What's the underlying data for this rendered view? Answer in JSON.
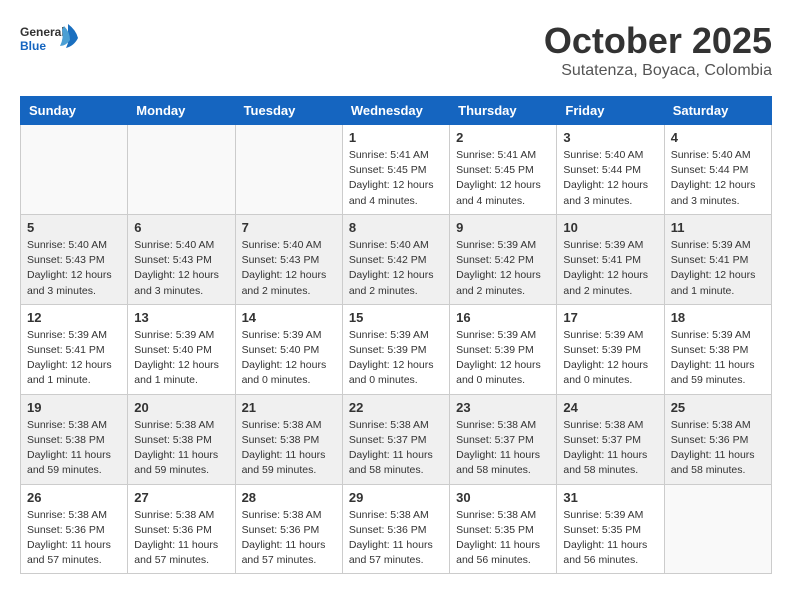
{
  "header": {
    "logo_general": "General",
    "logo_blue": "Blue",
    "month": "October 2025",
    "location": "Sutatenza, Boyaca, Colombia"
  },
  "days_of_week": [
    "Sunday",
    "Monday",
    "Tuesday",
    "Wednesday",
    "Thursday",
    "Friday",
    "Saturday"
  ],
  "weeks": [
    {
      "shaded": false,
      "days": [
        {
          "num": "",
          "info": ""
        },
        {
          "num": "",
          "info": ""
        },
        {
          "num": "",
          "info": ""
        },
        {
          "num": "1",
          "info": "Sunrise: 5:41 AM\nSunset: 5:45 PM\nDaylight: 12 hours\nand 4 minutes."
        },
        {
          "num": "2",
          "info": "Sunrise: 5:41 AM\nSunset: 5:45 PM\nDaylight: 12 hours\nand 4 minutes."
        },
        {
          "num": "3",
          "info": "Sunrise: 5:40 AM\nSunset: 5:44 PM\nDaylight: 12 hours\nand 3 minutes."
        },
        {
          "num": "4",
          "info": "Sunrise: 5:40 AM\nSunset: 5:44 PM\nDaylight: 12 hours\nand 3 minutes."
        }
      ]
    },
    {
      "shaded": true,
      "days": [
        {
          "num": "5",
          "info": "Sunrise: 5:40 AM\nSunset: 5:43 PM\nDaylight: 12 hours\nand 3 minutes."
        },
        {
          "num": "6",
          "info": "Sunrise: 5:40 AM\nSunset: 5:43 PM\nDaylight: 12 hours\nand 3 minutes."
        },
        {
          "num": "7",
          "info": "Sunrise: 5:40 AM\nSunset: 5:43 PM\nDaylight: 12 hours\nand 2 minutes."
        },
        {
          "num": "8",
          "info": "Sunrise: 5:40 AM\nSunset: 5:42 PM\nDaylight: 12 hours\nand 2 minutes."
        },
        {
          "num": "9",
          "info": "Sunrise: 5:39 AM\nSunset: 5:42 PM\nDaylight: 12 hours\nand 2 minutes."
        },
        {
          "num": "10",
          "info": "Sunrise: 5:39 AM\nSunset: 5:41 PM\nDaylight: 12 hours\nand 2 minutes."
        },
        {
          "num": "11",
          "info": "Sunrise: 5:39 AM\nSunset: 5:41 PM\nDaylight: 12 hours\nand 1 minute."
        }
      ]
    },
    {
      "shaded": false,
      "days": [
        {
          "num": "12",
          "info": "Sunrise: 5:39 AM\nSunset: 5:41 PM\nDaylight: 12 hours\nand 1 minute."
        },
        {
          "num": "13",
          "info": "Sunrise: 5:39 AM\nSunset: 5:40 PM\nDaylight: 12 hours\nand 1 minute."
        },
        {
          "num": "14",
          "info": "Sunrise: 5:39 AM\nSunset: 5:40 PM\nDaylight: 12 hours\nand 0 minutes."
        },
        {
          "num": "15",
          "info": "Sunrise: 5:39 AM\nSunset: 5:39 PM\nDaylight: 12 hours\nand 0 minutes."
        },
        {
          "num": "16",
          "info": "Sunrise: 5:39 AM\nSunset: 5:39 PM\nDaylight: 12 hours\nand 0 minutes."
        },
        {
          "num": "17",
          "info": "Sunrise: 5:39 AM\nSunset: 5:39 PM\nDaylight: 12 hours\nand 0 minutes."
        },
        {
          "num": "18",
          "info": "Sunrise: 5:39 AM\nSunset: 5:38 PM\nDaylight: 11 hours\nand 59 minutes."
        }
      ]
    },
    {
      "shaded": true,
      "days": [
        {
          "num": "19",
          "info": "Sunrise: 5:38 AM\nSunset: 5:38 PM\nDaylight: 11 hours\nand 59 minutes."
        },
        {
          "num": "20",
          "info": "Sunrise: 5:38 AM\nSunset: 5:38 PM\nDaylight: 11 hours\nand 59 minutes."
        },
        {
          "num": "21",
          "info": "Sunrise: 5:38 AM\nSunset: 5:38 PM\nDaylight: 11 hours\nand 59 minutes."
        },
        {
          "num": "22",
          "info": "Sunrise: 5:38 AM\nSunset: 5:37 PM\nDaylight: 11 hours\nand 58 minutes."
        },
        {
          "num": "23",
          "info": "Sunrise: 5:38 AM\nSunset: 5:37 PM\nDaylight: 11 hours\nand 58 minutes."
        },
        {
          "num": "24",
          "info": "Sunrise: 5:38 AM\nSunset: 5:37 PM\nDaylight: 11 hours\nand 58 minutes."
        },
        {
          "num": "25",
          "info": "Sunrise: 5:38 AM\nSunset: 5:36 PM\nDaylight: 11 hours\nand 58 minutes."
        }
      ]
    },
    {
      "shaded": false,
      "days": [
        {
          "num": "26",
          "info": "Sunrise: 5:38 AM\nSunset: 5:36 PM\nDaylight: 11 hours\nand 57 minutes."
        },
        {
          "num": "27",
          "info": "Sunrise: 5:38 AM\nSunset: 5:36 PM\nDaylight: 11 hours\nand 57 minutes."
        },
        {
          "num": "28",
          "info": "Sunrise: 5:38 AM\nSunset: 5:36 PM\nDaylight: 11 hours\nand 57 minutes."
        },
        {
          "num": "29",
          "info": "Sunrise: 5:38 AM\nSunset: 5:36 PM\nDaylight: 11 hours\nand 57 minutes."
        },
        {
          "num": "30",
          "info": "Sunrise: 5:38 AM\nSunset: 5:35 PM\nDaylight: 11 hours\nand 56 minutes."
        },
        {
          "num": "31",
          "info": "Sunrise: 5:39 AM\nSunset: 5:35 PM\nDaylight: 11 hours\nand 56 minutes."
        },
        {
          "num": "",
          "info": ""
        }
      ]
    }
  ]
}
